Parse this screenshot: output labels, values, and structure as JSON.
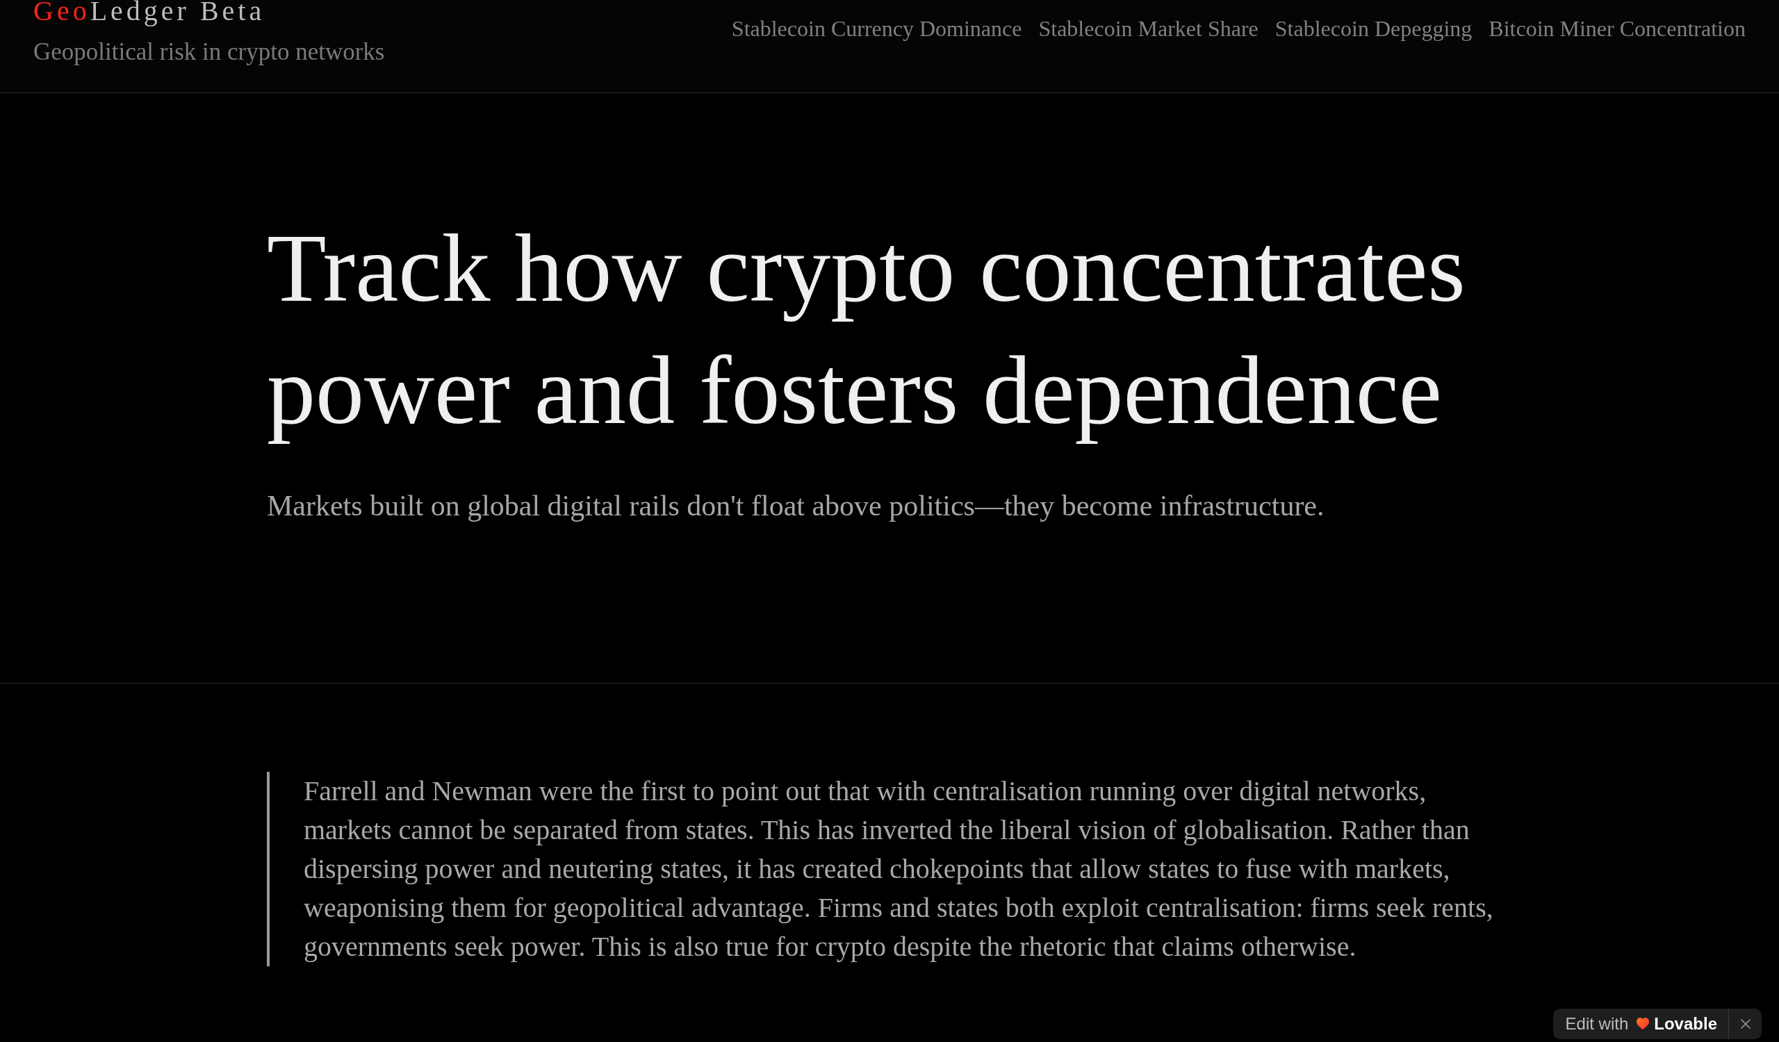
{
  "header": {
    "logo": {
      "accent": "Geo",
      "text": "Ledger Beta"
    },
    "tagline": "Geopolitical risk in crypto networks",
    "nav": [
      "Stablecoin Currency Dominance",
      "Stablecoin Market Share",
      "Stablecoin Depegging",
      "Bitcoin Miner Concentration"
    ]
  },
  "hero": {
    "title": "Track how crypto concentrates power and fosters dependence",
    "subtitle": "Markets built on global digital rails don't float above politics—they become infrastructure."
  },
  "quote": {
    "text": "Farrell and Newman were the first to point out that with centralisation running over digital networks, markets cannot be separated from states. This has inverted the liberal vision of globalisation. Rather than dispersing power and neutering states, it has created chokepoints that allow states to fuse with markets, weaponising them for geopolitical advantage. Firms and states both exploit centralisation: firms seek rents, governments seek power. This is also true for crypto despite the rhetoric that claims otherwise."
  },
  "badge": {
    "prefix": "Edit with",
    "brand": "Lovable"
  }
}
